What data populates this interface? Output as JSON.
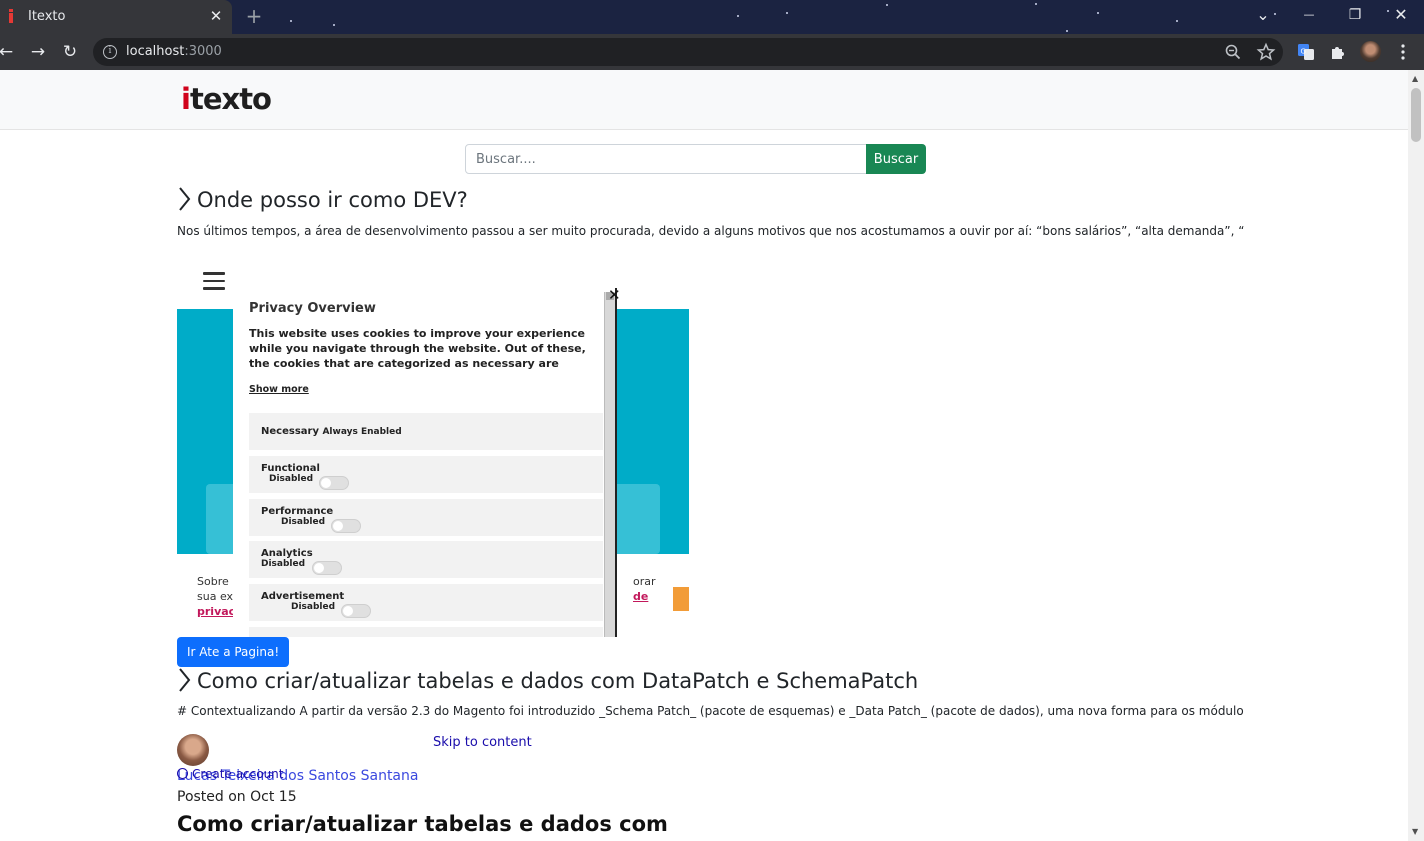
{
  "browser": {
    "tab_title": "Itexto",
    "tab_close": "✕",
    "new_tab": "+",
    "url_host": "localhost",
    "url_port": ":3000",
    "info_glyph": "i",
    "controls": {
      "dropdown": "⌄",
      "minimize": "—",
      "restore": "❐",
      "close": "✕"
    },
    "nav": {
      "back": "←",
      "forward": "→",
      "reload": "↻"
    }
  },
  "site": {
    "logo_i": "i",
    "logo_rest": "texto",
    "search_placeholder": "Buscar....",
    "search_button": "Buscar"
  },
  "posts": [
    {
      "title": "Onde posso ir como DEV?",
      "excerpt": "Nos últimos tempos, a área de desenvolvimento passou a ser muito procurada, devido a alguns motivos que nos acostumamos a ouvir por aí: “bons salários”, “alta demanda”, “"
    },
    {
      "title": "Como criar/atualizar tabelas e dados com DataPatch e SchemaPatch",
      "excerpt": "# Contextualizando A partir da versão 2.3 do Magento foi introduzido _Schema Patch_ (pacote de esquemas) e _Data Patch_ (pacote de dados), uma nova forma para os módulo"
    }
  ],
  "embed": {
    "cookie_text_line1": "Sobre",
    "cookie_text_line2": "sua ex",
    "cookie_link": "privaci",
    "cookie_right_line1": "orar",
    "cookie_right_link": "de",
    "privacy": {
      "title": "Privacy Overview",
      "description": "This website uses cookies to improve your experience while you navigate through the website. Out of these, the cookies that are categorized as necessary are stored on your browser as they are",
      "show_more": "Show more",
      "close": "✕",
      "categories": [
        {
          "name": "Necessary",
          "state": "Always Enabled"
        },
        {
          "name": "Functional",
          "state": "Disabled"
        },
        {
          "name": "Performance",
          "state": "Disabled"
        },
        {
          "name": "Analytics",
          "state": "Disabled"
        },
        {
          "name": "Advertisement",
          "state": "Disabled"
        }
      ]
    }
  },
  "go_button": "Ir Ate a Pagina!",
  "article": {
    "skip_link": "Skip to content",
    "create_account": "Create account",
    "author": "Lucas Teixeira dos Santos Santana",
    "posted": "Posted on Oct 15",
    "heading": "Como criar/atualizar tabelas e dados com"
  }
}
